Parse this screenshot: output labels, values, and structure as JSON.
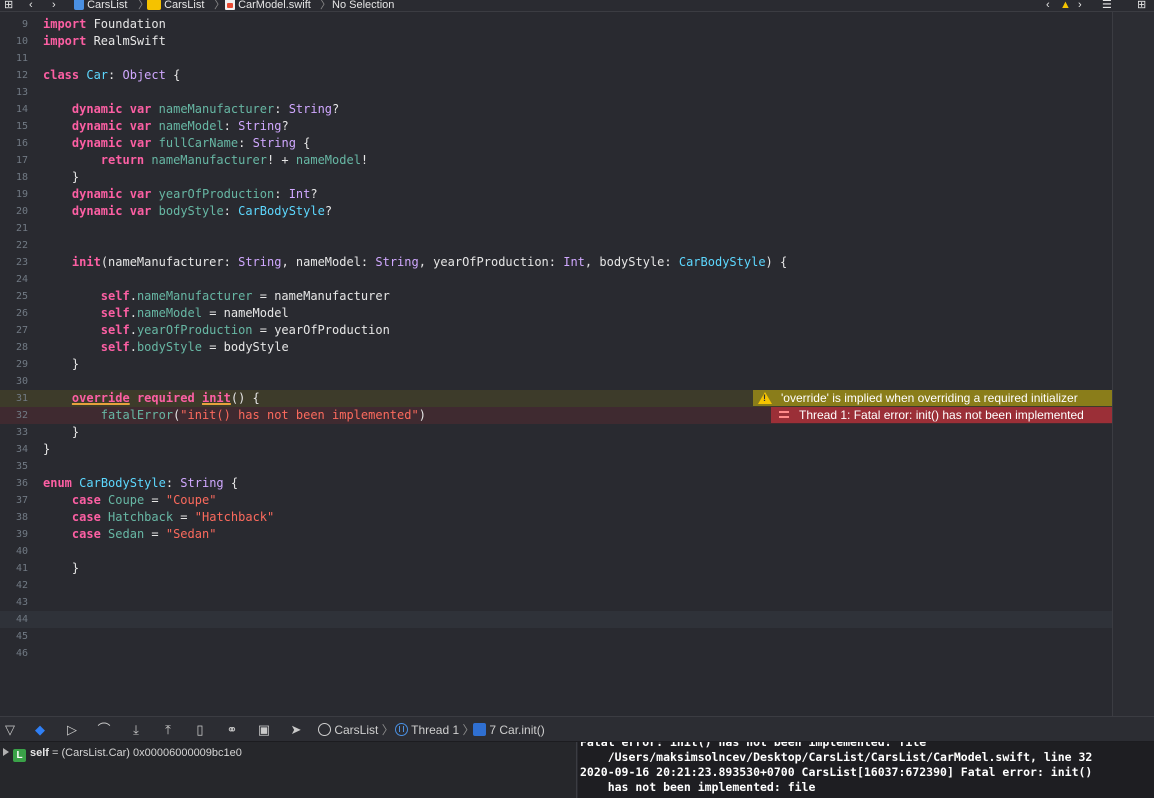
{
  "jumpbar": {
    "project": "CarsList",
    "group": "CarsList",
    "file": "CarModel.swift",
    "selection": "No Selection"
  },
  "annotations": {
    "warning": "'override' is implied when overriding a required initializer",
    "error": "Thread 1: Fatal error: init() has not been implemented"
  },
  "code_lines": [
    {
      "n": "9",
      "t": [
        [
          "kw",
          "import"
        ],
        [
          "p",
          " Foundation"
        ]
      ]
    },
    {
      "n": "10",
      "t": [
        [
          "kw",
          "import"
        ],
        [
          "p",
          " RealmSwift"
        ]
      ]
    },
    {
      "n": "11",
      "t": []
    },
    {
      "n": "12",
      "t": [
        [
          "kw",
          "class"
        ],
        [
          "p",
          " "
        ],
        [
          "cls",
          "Car"
        ],
        [
          "p",
          ": "
        ],
        [
          "ty",
          "Object"
        ],
        [
          "p",
          " {"
        ]
      ]
    },
    {
      "n": "13",
      "t": []
    },
    {
      "n": "14",
      "t": [
        [
          "p",
          "    "
        ],
        [
          "kw",
          "dynamic"
        ],
        [
          "p",
          " "
        ],
        [
          "kw",
          "var"
        ],
        [
          "p",
          " "
        ],
        [
          "prop",
          "nameManufacturer"
        ],
        [
          "p",
          ": "
        ],
        [
          "ty",
          "String"
        ],
        [
          "p",
          "?"
        ]
      ]
    },
    {
      "n": "15",
      "t": [
        [
          "p",
          "    "
        ],
        [
          "kw",
          "dynamic"
        ],
        [
          "p",
          " "
        ],
        [
          "kw",
          "var"
        ],
        [
          "p",
          " "
        ],
        [
          "prop",
          "nameModel"
        ],
        [
          "p",
          ": "
        ],
        [
          "ty",
          "String"
        ],
        [
          "p",
          "?"
        ]
      ]
    },
    {
      "n": "16",
      "t": [
        [
          "p",
          "    "
        ],
        [
          "kw",
          "dynamic"
        ],
        [
          "p",
          " "
        ],
        [
          "kw",
          "var"
        ],
        [
          "p",
          " "
        ],
        [
          "prop",
          "fullCarName"
        ],
        [
          "p",
          ": "
        ],
        [
          "ty",
          "String"
        ],
        [
          "p",
          " {"
        ]
      ]
    },
    {
      "n": "17",
      "t": [
        [
          "p",
          "        "
        ],
        [
          "kw",
          "return"
        ],
        [
          "p",
          " "
        ],
        [
          "prop",
          "nameManufacturer"
        ],
        [
          "p",
          "! + "
        ],
        [
          "prop",
          "nameModel"
        ],
        [
          "p",
          "!"
        ]
      ]
    },
    {
      "n": "18",
      "t": [
        [
          "p",
          "    }"
        ]
      ]
    },
    {
      "n": "19",
      "t": [
        [
          "p",
          "    "
        ],
        [
          "kw",
          "dynamic"
        ],
        [
          "p",
          " "
        ],
        [
          "kw",
          "var"
        ],
        [
          "p",
          " "
        ],
        [
          "prop",
          "yearOfProduction"
        ],
        [
          "p",
          ": "
        ],
        [
          "ty",
          "Int"
        ],
        [
          "p",
          "?"
        ]
      ]
    },
    {
      "n": "20",
      "t": [
        [
          "p",
          "    "
        ],
        [
          "kw",
          "dynamic"
        ],
        [
          "p",
          " "
        ],
        [
          "kw",
          "var"
        ],
        [
          "p",
          " "
        ],
        [
          "prop",
          "bodyStyle"
        ],
        [
          "p",
          ": "
        ],
        [
          "cls",
          "CarBodyStyle"
        ],
        [
          "p",
          "?"
        ]
      ]
    },
    {
      "n": "21",
      "t": []
    },
    {
      "n": "22",
      "t": []
    },
    {
      "n": "23",
      "t": [
        [
          "p",
          "    "
        ],
        [
          "kw",
          "init"
        ],
        [
          "p",
          "(nameManufacturer: "
        ],
        [
          "ty",
          "String"
        ],
        [
          "p",
          ", nameModel: "
        ],
        [
          "ty",
          "String"
        ],
        [
          "p",
          ", yearOfProduction: "
        ],
        [
          "ty",
          "Int"
        ],
        [
          "p",
          ", bodyStyle: "
        ],
        [
          "cls",
          "CarBodyStyle"
        ],
        [
          "p",
          ") {"
        ]
      ]
    },
    {
      "n": "24",
      "t": []
    },
    {
      "n": "25",
      "t": [
        [
          "p",
          "        "
        ],
        [
          "kw",
          "self"
        ],
        [
          "p",
          "."
        ],
        [
          "prop",
          "nameManufacturer"
        ],
        [
          "p",
          " = nameManufacturer"
        ]
      ]
    },
    {
      "n": "26",
      "t": [
        [
          "p",
          "        "
        ],
        [
          "kw",
          "self"
        ],
        [
          "p",
          "."
        ],
        [
          "prop",
          "nameModel"
        ],
        [
          "p",
          " = nameModel"
        ]
      ]
    },
    {
      "n": "27",
      "t": [
        [
          "p",
          "        "
        ],
        [
          "kw",
          "self"
        ],
        [
          "p",
          "."
        ],
        [
          "prop",
          "yearOfProduction"
        ],
        [
          "p",
          " = yearOfProduction"
        ]
      ]
    },
    {
      "n": "28",
      "t": [
        [
          "p",
          "        "
        ],
        [
          "kw",
          "self"
        ],
        [
          "p",
          "."
        ],
        [
          "prop",
          "bodyStyle"
        ],
        [
          "p",
          " = bodyStyle"
        ]
      ]
    },
    {
      "n": "29",
      "t": [
        [
          "p",
          "    }"
        ]
      ]
    },
    {
      "n": "30",
      "t": []
    },
    {
      "n": "31",
      "t": [
        [
          "p",
          "    "
        ],
        [
          "kwsq",
          "override"
        ],
        [
          "p",
          " "
        ],
        [
          "kw",
          "required"
        ],
        [
          "p",
          " "
        ],
        [
          "kwsq",
          "init"
        ],
        [
          "p",
          "() {"
        ]
      ]
    },
    {
      "n": "32",
      "t": [
        [
          "p",
          "        "
        ],
        [
          "prop",
          "fatalError"
        ],
        [
          "p",
          "("
        ],
        [
          "str",
          "\"init() has not been implemented\""
        ],
        [
          "p",
          ")"
        ]
      ]
    },
    {
      "n": "33",
      "t": [
        [
          "p",
          "    }"
        ]
      ]
    },
    {
      "n": "34",
      "t": [
        [
          "p",
          "}"
        ]
      ]
    },
    {
      "n": "35",
      "t": []
    },
    {
      "n": "36",
      "t": [
        [
          "kw",
          "enum"
        ],
        [
          "p",
          " "
        ],
        [
          "cls",
          "CarBodyStyle"
        ],
        [
          "p",
          ": "
        ],
        [
          "ty",
          "String"
        ],
        [
          "p",
          " {"
        ]
      ]
    },
    {
      "n": "37",
      "t": [
        [
          "p",
          "    "
        ],
        [
          "kw",
          "case"
        ],
        [
          "p",
          " "
        ],
        [
          "prop",
          "Coupe"
        ],
        [
          "p",
          " = "
        ],
        [
          "str",
          "\"Coupe\""
        ]
      ]
    },
    {
      "n": "38",
      "t": [
        [
          "p",
          "    "
        ],
        [
          "kw",
          "case"
        ],
        [
          "p",
          " "
        ],
        [
          "prop",
          "Hatchback"
        ],
        [
          "p",
          " = "
        ],
        [
          "str",
          "\"Hatchback\""
        ]
      ]
    },
    {
      "n": "39",
      "t": [
        [
          "p",
          "    "
        ],
        [
          "kw",
          "case"
        ],
        [
          "p",
          " "
        ],
        [
          "prop",
          "Sedan"
        ],
        [
          "p",
          " = "
        ],
        [
          "str",
          "\"Sedan\""
        ]
      ]
    },
    {
      "n": "40",
      "t": []
    },
    {
      "n": "41",
      "t": [
        [
          "p",
          "    }"
        ]
      ]
    },
    {
      "n": "42",
      "t": []
    },
    {
      "n": "43",
      "t": []
    },
    {
      "n": "44",
      "t": []
    },
    {
      "n": "45",
      "t": []
    },
    {
      "n": "46",
      "t": []
    }
  ],
  "debug_breadcrumb": {
    "target": "CarsList",
    "thread": "Thread 1",
    "frame": "7 Car.init()"
  },
  "variables": {
    "name": "self",
    "value": " = (CarsList.Car) 0x00006000009bc1e0"
  },
  "console_lines": [
    "Fatal error: init() has not been implemented: file",
    "    /Users/maksimsolncev/Desktop/CarsList/CarsList/CarModel.swift, line 32",
    "2020-09-16 20:21:23.893530+0700 CarsList[16037:672390] Fatal error: init()",
    "    has not been implemented: file"
  ]
}
